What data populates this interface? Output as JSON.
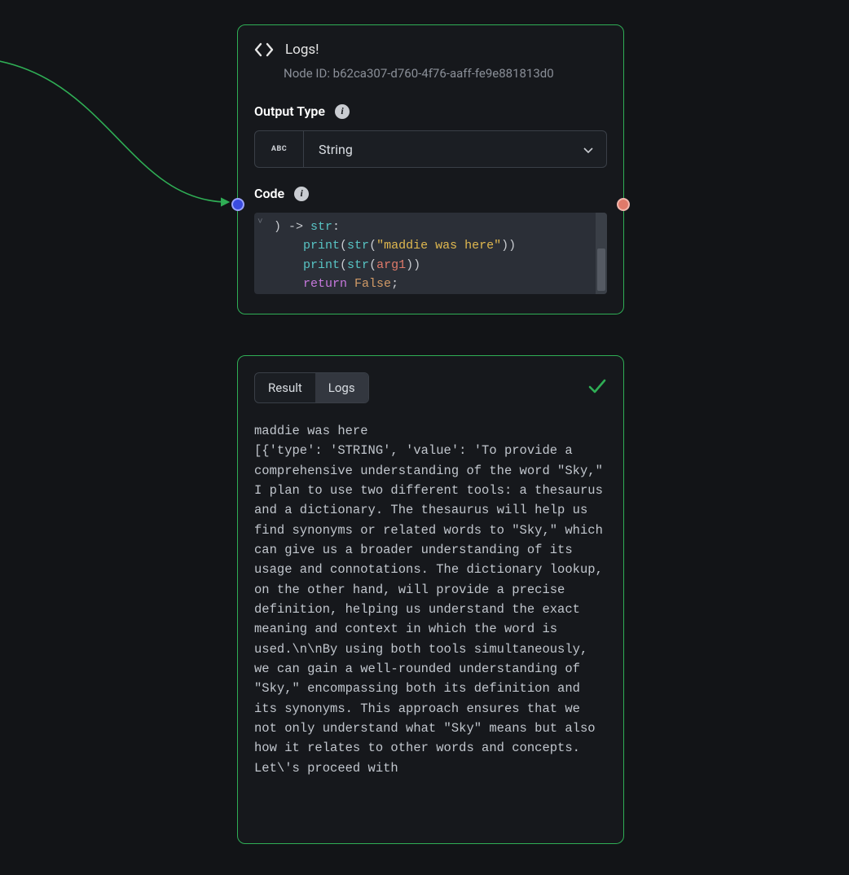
{
  "node": {
    "title": "Logs!",
    "id_label": "Node ID: b62ca307-d760-4f76-aaff-fe9e881813d0",
    "output_type_label": "Output Type",
    "output_type_value": "String",
    "output_type_prefix": "ABC",
    "code_label": "Code",
    "code": {
      "line1_paren": ")",
      "line1_arrow": " -> ",
      "line1_type": "str",
      "line1_colon": ":",
      "line2_indent": "    ",
      "line2_print": "print",
      "line2_p1": "(",
      "line2_str": "str",
      "line2_p2": "(",
      "line2_literal": "\"maddie was here\"",
      "line2_close": "))",
      "line3_indent": "    ",
      "line3_print": "print",
      "line3_p1": "(",
      "line3_str": "str",
      "line3_p2": "(",
      "line3_arg": "arg1",
      "line3_close": "))",
      "line4_indent": "    ",
      "line4_return": "return",
      "line4_space": " ",
      "line4_false": "False",
      "line4_semi": ";"
    }
  },
  "result": {
    "tabs": {
      "result": "Result",
      "logs": "Logs"
    },
    "output": "maddie was here\n[{'type': 'STRING', 'value': 'To provide a comprehensive understanding of the word \"Sky,\" I plan to use two different tools: a thesaurus and a dictionary. The thesaurus will help us find synonyms or related words to \"Sky,\" which can give us a broader understanding of its usage and connotations. The dictionary lookup, on the other hand, will provide a precise definition, helping us understand the exact meaning and context in which the word is used.\\n\\nBy using both tools simultaneously, we can gain a well-rounded understanding of \"Sky,\" encompassing both its definition and its synonyms. This approach ensures that we not only understand what \"Sky\" means but also how it relates to other words and concepts. Let\\'s proceed with"
  },
  "icons": {
    "info": "i",
    "caret": "▾",
    "gutter": "˅"
  },
  "colors": {
    "accent": "#2fae55",
    "port_in": "#3a4bdf",
    "port_out": "#e07a6a"
  }
}
